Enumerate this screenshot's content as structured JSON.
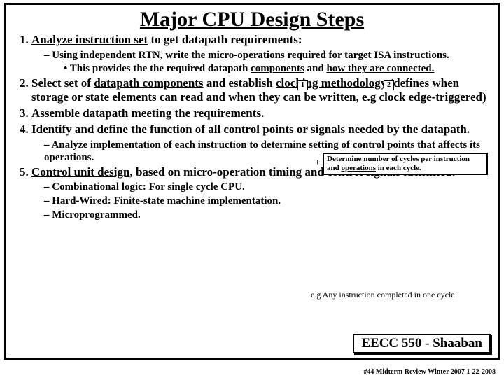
{
  "title": "Major CPU Design Steps",
  "items": {
    "i1": {
      "pre": "",
      "u": "Analyze instruction set",
      "post": " to get datapath requirements:"
    },
    "i1s1": "Using independent RTN, write the micro-operations required for target ISA instructions.",
    "i1s1b": {
      "pre": "This provides the the required datapath ",
      "u1": "components",
      "mid": " and ",
      "u2": "how they are connected."
    },
    "i2": {
      "pre": "Select set of ",
      "u1": "datapath components",
      "mid": " and establish ",
      "u2": "clocking methodology",
      "post": " (defines when storage or state elements can read and when they can be written, e.g clock edge-triggered)"
    },
    "i3": {
      "u": "Assemble datapath",
      "post": " meeting the requirements."
    },
    "i4": {
      "pre": "Identify and define the ",
      "u": "function of all control points or signals",
      "post": " needed by the datapath."
    },
    "i4s1": "Analyze implementation of each instruction to determine setting of control points that affects its operations.",
    "i5": {
      "u": "Control unit design",
      "post": ", based on micro-operation timing and control signals identified:"
    },
    "i5s1": "Combinational logic: For single cycle CPU.",
    "i5s2": "Hard-Wired:  Finite-state machine implementation.",
    "i5s3": "Microprogrammed."
  },
  "callouts": {
    "num1": "1",
    "num2": "2",
    "determine": {
      "pre": "Determine ",
      "u1": "number",
      "mid1": " of cycles per instruction and ",
      "u2": "operations",
      "mid2": " in each cycle."
    },
    "eg_single": "e.g Any instruction completed in one cycle",
    "plus": "+"
  },
  "course": "EECC 550 - Shaaban",
  "footer": "#44  Midterm Review  Winter 2007  1-22-2008"
}
